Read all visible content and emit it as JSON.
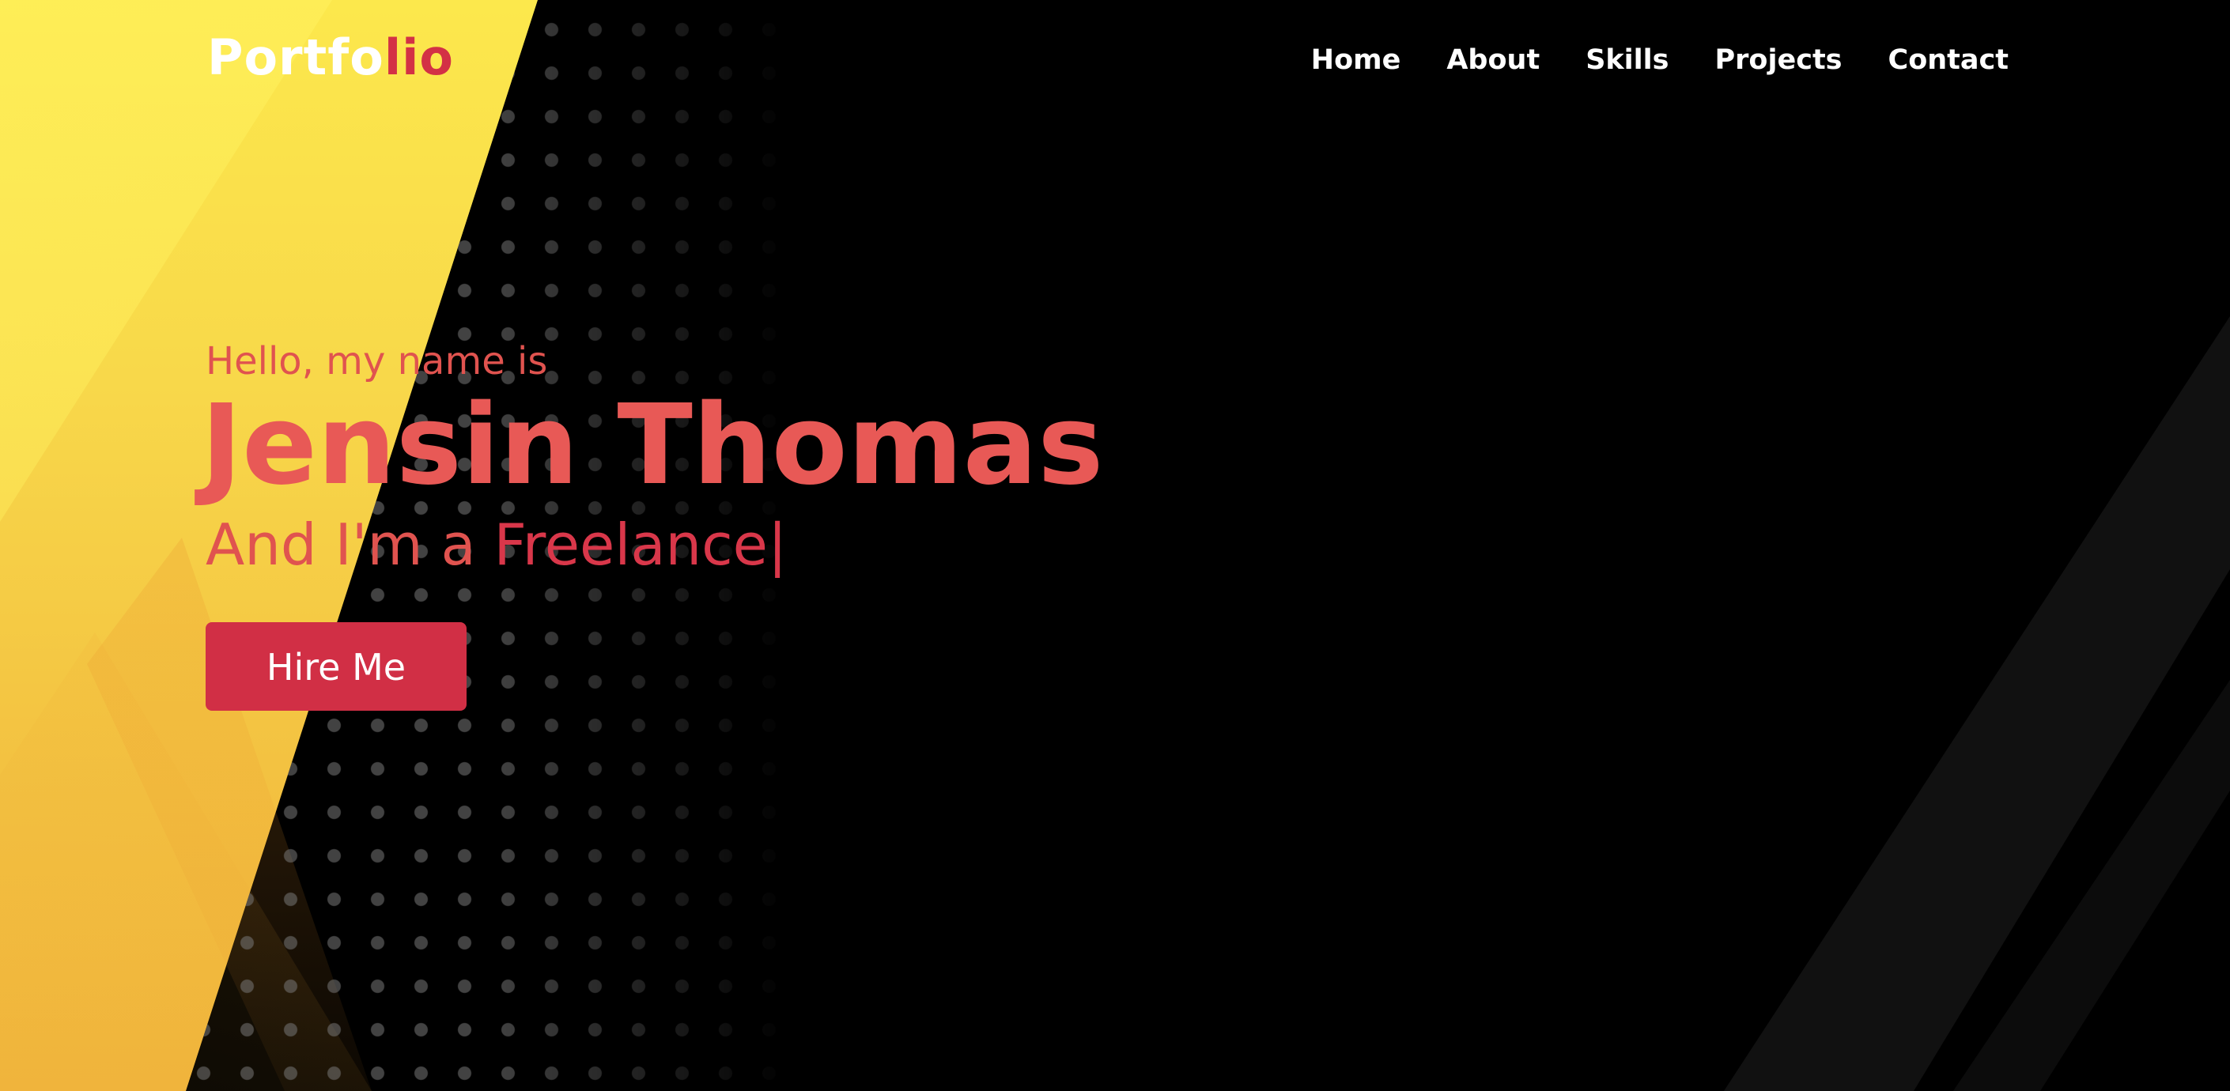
{
  "brand": {
    "logo_main": "Portfo",
    "logo_accent": "lio"
  },
  "nav": {
    "items": [
      {
        "label": "Home"
      },
      {
        "label": "About"
      },
      {
        "label": "Skills"
      },
      {
        "label": "Projects"
      },
      {
        "label": "Contact"
      }
    ]
  },
  "hero": {
    "greeting": "Hello, my name is",
    "name": "Jensin Thomas",
    "role_prefix": "And I'm a ",
    "role_word": "Freelance",
    "cursor": "|",
    "cta_label": "Hire Me"
  },
  "colors": {
    "accent": "#d12f45",
    "text_accent": "#e85956",
    "background": "#000000",
    "yellow": "#fce84c",
    "nav_text": "#ffffff"
  }
}
